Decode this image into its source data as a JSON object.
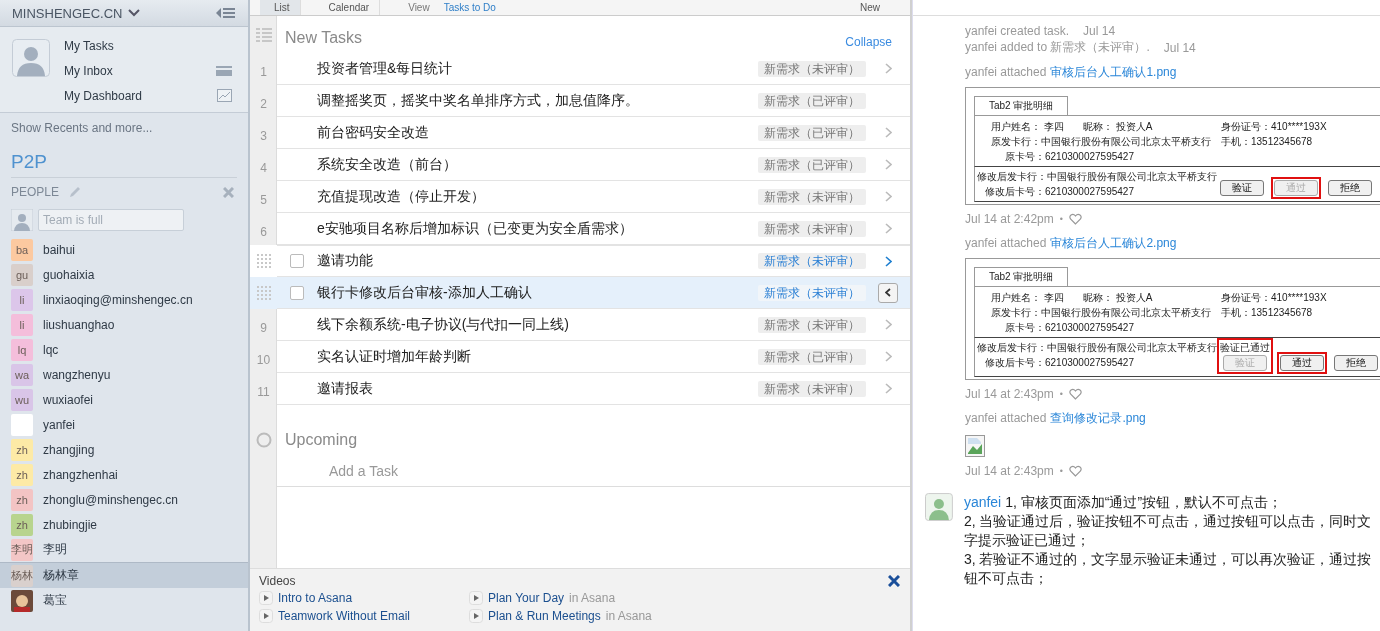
{
  "sidebar": {
    "workspace": "MINSHENGEC.CN",
    "nav": [
      {
        "label": "My Tasks",
        "kind": "plain"
      },
      {
        "label": "My Inbox",
        "kind": "inbox"
      },
      {
        "label": "My Dashboard",
        "kind": "chart"
      }
    ],
    "recents": "Show Recents and more...",
    "project": "P2P",
    "people_heading": "PEOPLE",
    "team_field": {
      "placeholder": "Team is full"
    },
    "people": [
      {
        "name": "baihui",
        "initials": "ba",
        "color": "#fcc9a0",
        "kind": "initials",
        "selected": false
      },
      {
        "name": "guohaixia",
        "initials": "gu",
        "color": "#d9cfcb",
        "kind": "initials",
        "selected": false
      },
      {
        "name": "linxiaoqing@minshengec.cn",
        "initials": "li",
        "color": "#dcc6ea",
        "kind": "initials",
        "selected": false
      },
      {
        "name": "liushuanghao",
        "initials": "li",
        "color": "#f4bedb",
        "kind": "initials",
        "selected": false
      },
      {
        "name": "lqc",
        "initials": "lq",
        "color": "#f4bedb",
        "kind": "initials",
        "selected": false
      },
      {
        "name": "wangzhenyu",
        "initials": "wa",
        "color": "#d9c5e8",
        "kind": "initials",
        "selected": false
      },
      {
        "name": "wuxiaofei",
        "initials": "wu",
        "color": "#d9c5e8",
        "kind": "initials",
        "selected": false
      },
      {
        "name": "yanfei",
        "color": "#ffffff",
        "kind": "blank",
        "selected": false
      },
      {
        "name": "zhangjing",
        "initials": "zh",
        "color": "#fdeaa6",
        "kind": "initials",
        "selected": false
      },
      {
        "name": "zhangzhenhai",
        "initials": "zh",
        "color": "#fdeaa6",
        "kind": "initials",
        "selected": false
      },
      {
        "name": "zhonglu@minshengec.cn",
        "initials": "zh",
        "color": "#f3c4c4",
        "kind": "initials",
        "selected": false
      },
      {
        "name": "zhubingjie",
        "initials": "zh",
        "color": "#b8d48e",
        "kind": "initials",
        "selected": false
      },
      {
        "name": "李明",
        "initials": "李明",
        "color": "#f3c6c6",
        "kind": "initials",
        "selected": false
      },
      {
        "name": "杨林章",
        "initials": "杨林",
        "color": "#d9d0cd",
        "kind": "initials",
        "selected": true
      },
      {
        "name": "葛宝",
        "kind": "photo",
        "selected": false
      }
    ]
  },
  "toolbar": {
    "tabs": [
      {
        "label": "List",
        "selected": true
      },
      {
        "label": "Calendar",
        "selected": false
      }
    ],
    "view_label": "View",
    "view_value": "Tasks to Do",
    "new_button": "New"
  },
  "tasks": {
    "section": "New Tasks",
    "collapse": "Collapse",
    "rows": [
      {
        "number": "1",
        "title": "投资者管理&每日统计",
        "tag": "新需求（未评审）",
        "chevron": true,
        "hovered": false,
        "selected": false
      },
      {
        "number": "2",
        "title": "调整摇奖页，摇奖中奖名单排序方式，加息值降序。",
        "tag": "新需求（已评审）",
        "chevron": false,
        "hovered": false,
        "selected": false
      },
      {
        "number": "3",
        "title": "前台密码安全改造",
        "tag": "新需求（已评审）",
        "chevron": true,
        "hovered": false,
        "selected": false
      },
      {
        "number": "4",
        "title": "系统安全改造（前台）",
        "tag": "新需求（已评审）",
        "chevron": true,
        "hovered": false,
        "selected": false
      },
      {
        "number": "5",
        "title": "充值提现改造（停止开发）",
        "tag": "新需求（未评审）",
        "chevron": true,
        "hovered": false,
        "selected": false
      },
      {
        "number": "6",
        "title": "e安驰项目名称后增加标识（已变更为安全盾需求）",
        "tag": "新需求（未评审）",
        "chevron": true,
        "hovered": false,
        "selected": false
      },
      {
        "title": "邀请功能",
        "tag": "新需求（未评审）",
        "chevron": true,
        "hovered": true,
        "selected": false
      },
      {
        "title": "银行卡修改后台审核-添加人工确认",
        "tag": "新需求（未评审）",
        "chevron": true,
        "hovered": false,
        "selected": true
      },
      {
        "number": "9",
        "title": "线下余额系统-电子协议(与代扣一同上线)",
        "tag": "新需求（未评审）",
        "chevron": true,
        "hovered": false,
        "selected": false
      },
      {
        "number": "10",
        "title": "实名认证时增加年龄判断",
        "tag": "新需求（已评审）",
        "chevron": true,
        "hovered": false,
        "selected": false
      },
      {
        "number": "11",
        "title": "邀请报表",
        "tag": "新需求（未评审）",
        "chevron": true,
        "hovered": false,
        "selected": false
      }
    ],
    "upcoming": "Upcoming",
    "add_task": "Add a Task"
  },
  "videos": {
    "title": "Videos",
    "links": [
      {
        "label": "Intro to Asana"
      },
      {
        "label": "Plan Your Day",
        "suffix": "in Asana"
      },
      {
        "label": "Teamwork Without Email"
      },
      {
        "label": "Plan & Run Meetings",
        "suffix": "in Asana"
      }
    ]
  },
  "activity": [
    {
      "kind": "story",
      "text": "yanfei created task.",
      "date": "Jul 14"
    },
    {
      "kind": "story",
      "text": "yanfei added to 新需求（未评审）.",
      "date": "Jul 14"
    },
    {
      "kind": "attachment",
      "text": "yanfei attached",
      "file": "审核后台人工确认1.png",
      "time": "Jul 14 at 2:42pm",
      "separator": "•",
      "doc": {
        "tab": "Tab2 审批明细",
        "name": "用户姓名： 李四",
        "nickname": "昵称： 投资人A",
        "id_no": "身份证号：410****193X",
        "bank": "原发卡行：中国银行股份有限公司北京太平桥支行",
        "phone": "手机：13512345678",
        "card": "原卡号：6210300027595427",
        "new_bank": "修改后发卡行：中国银行股份有限公司北京太平桥支行",
        "new_card": "修改后卡号：6210300027595427",
        "buttons": [
          {
            "label": "验证",
            "disabled": false,
            "highlighted": false
          },
          {
            "label": "通过",
            "disabled": true,
            "highlighted": true
          },
          {
            "label": "拒绝",
            "disabled": false,
            "highlighted": false
          }
        ]
      }
    },
    {
      "kind": "attachment",
      "text": "yanfei attached",
      "file": "审核后台人工确认2.png",
      "time": "Jul 14 at 2:43pm",
      "separator": "•",
      "doc": {
        "tab": "Tab2 审批明细",
        "name": "用户姓名： 李四",
        "nickname": "昵称： 投资人A",
        "id_no": "身份证号：410****193X",
        "bank": "原发卡行：中国银行股份有限公司北京太平桥支行",
        "phone": "手机：13512345678",
        "card": "原卡号：6210300027595427",
        "new_bank": "修改后发卡行：中国银行股份有限公司北京太平桥支行",
        "new_card": "修改后卡号：6210300027595427",
        "buttons": [
          {
            "label": "验证",
            "note": "验证已通过",
            "disabled": true,
            "highlighted": true
          },
          {
            "label": "通过",
            "disabled": false,
            "highlighted": true
          },
          {
            "label": "拒绝",
            "disabled": false,
            "highlighted": false
          }
        ]
      }
    },
    {
      "kind": "broken",
      "text": "yanfei attached",
      "file": "查询修改记录.png",
      "time": "Jul 14 at 2:43pm",
      "separator": "•"
    },
    {
      "kind": "comment",
      "user": "yanfei",
      "lines": [
        "1, 审核页面添加“通过”按钮，默认不可点击；",
        "2, 当验证通过后，验证按钮不可点击，通过按钮可以点击，同时文字提示验证已通过；",
        "3, 若验证不通过的，文字显示验证未通过，可以再次验证，通过按钮不可点击；"
      ]
    }
  ]
}
